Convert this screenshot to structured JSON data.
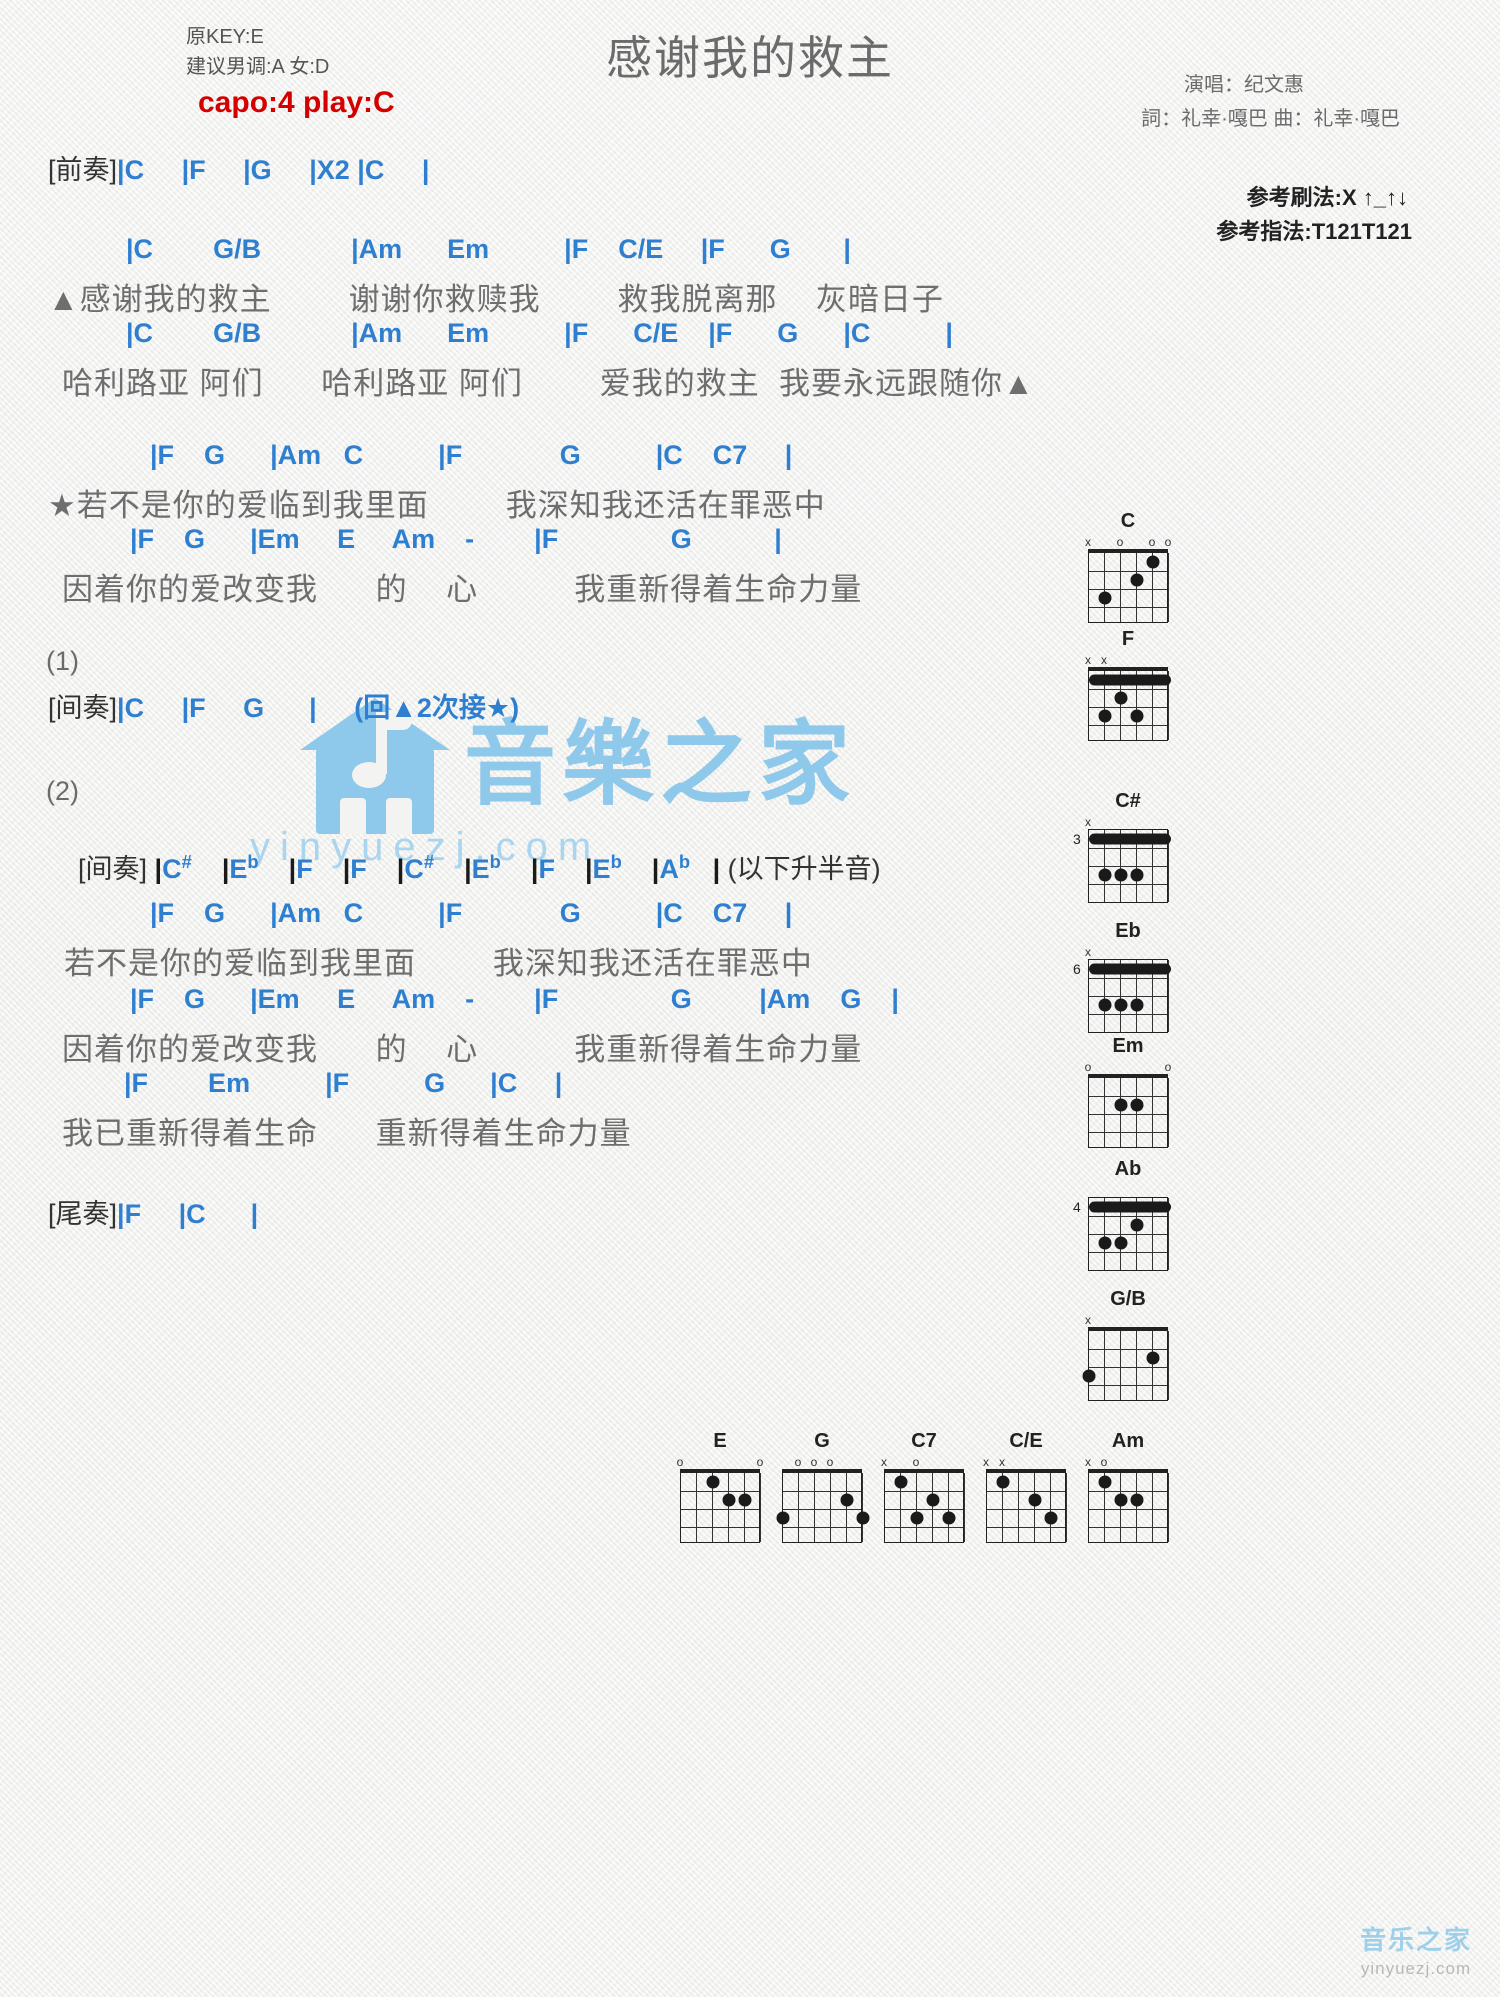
{
  "header": {
    "orig_key": "原KEY:E",
    "suggest_key": "建议男调:A 女:D",
    "capo": "capo:4 play:C",
    "title": "感谢我的救主",
    "singer": "演唱：纪文惠",
    "writers": "詞：礼幸·嘎巴   曲：礼幸·嘎巴",
    "strum_ref": "参考刷法:X ↑_↑↓",
    "finger_ref": "参考指法:T121T121",
    "capo_color": "#d40000",
    "chord_color": "#2f7fd0",
    "lyric_color": "#6e6e6e"
  },
  "body": {
    "intro_tag": "[前奏]",
    "intro_chords": "|C     |F     |G     |X2 |C     |",
    "v1_chords": "|C        G/B            |Am      Em          |F    C/E     |F      G       |",
    "v1_lyrics": "▲感谢我的救主        谢谢你救赎我        救我脱离那    灰暗日子",
    "v2_chords": "|C        G/B            |Am      Em          |F      C/E    |F      G      |C          |",
    "v2_lyrics": "哈利路亚 阿们      哈利路亚 阿们        爱我的救主  我要永远跟随你▲",
    "c1_chords": "|F    G      |Am   C          |F             G          |C    C7     |",
    "c1_lyrics": "★若不是你的爱临到我里面        我深知我还活在罪恶中",
    "c2_chords": "|F    G      |Em     E     Am    -        |F               G           |",
    "c2_lyrics": "因着你的爱改变我      的    心          我重新得着生命力量",
    "num1": "(1)",
    "inter1_tag": "[间奏]",
    "inter1_chords": "|C     |F     G      |     (回▲2次接★)",
    "num2": "(2)",
    "inter2_tag": "[间奏]",
    "inter2_chords_parts": [
      {
        "root": "C",
        "acc": "#"
      },
      {
        "root": "E",
        "acc": "b"
      },
      {
        "root": "F",
        "acc": ""
      },
      {
        "root": "F",
        "acc": ""
      },
      {
        "root": "C",
        "acc": "#"
      },
      {
        "root": "E",
        "acc": "b"
      },
      {
        "root": "F",
        "acc": ""
      },
      {
        "root": "E",
        "acc": "b"
      },
      {
        "root": "A",
        "acc": "b"
      }
    ],
    "inter2_note": "(以下升半音)",
    "c3_chords": "|F    G      |Am   C          |F             G          |C    C7     |",
    "c3_lyrics": "若不是你的爱临到我里面        我深知我还活在罪恶中",
    "c4_chords": "|F    G      |Em     E     Am    -        |F               G         |Am    G    |",
    "c4_lyrics": "因着你的爱改变我      的    心          我重新得着生命力量",
    "c5_chords": "|F        Em          |F          G      |C     |",
    "c5_lyrics": "我已重新得着生命      重新得着生命力量",
    "outro_tag": "[尾奏]",
    "outro_chords": "|F     |C      |"
  },
  "watermark": {
    "brand": "音樂之家",
    "url": "yinyuezj.com",
    "corner_brand": "音乐之家",
    "corner_url": "yinyuezj.com"
  },
  "diagrams_right": [
    {
      "name": "C",
      "base": 0,
      "open": [
        "x",
        "",
        "o",
        "",
        "o",
        "o"
      ],
      "dots": [
        [
          5,
          1
        ],
        [
          4,
          2
        ],
        [
          2,
          3
        ]
      ],
      "barre": null
    },
    {
      "name": "F",
      "base": 0,
      "open": [
        "x",
        "x",
        "",
        "",
        "",
        ""
      ],
      "dots": [
        [
          3,
          2
        ],
        [
          2,
          3
        ],
        [
          4,
          3
        ]
      ],
      "barre": {
        "fret": 1,
        "from": 1,
        "to": 6
      }
    },
    {
      "name": "C#",
      "base": 3,
      "open": [
        "x",
        "",
        "",
        "",
        "",
        ""
      ],
      "dots": [
        [
          3,
          3
        ],
        [
          4,
          3
        ],
        [
          2,
          3
        ]
      ],
      "barre": {
        "fret": 1,
        "from": 1,
        "to": 6
      }
    },
    {
      "name": "Eb",
      "base": 6,
      "open": [
        "x",
        "",
        "",
        "",
        "",
        ""
      ],
      "dots": [
        [
          3,
          3
        ],
        [
          4,
          3
        ],
        [
          2,
          3
        ]
      ],
      "barre": {
        "fret": 1,
        "from": 1,
        "to": 6
      }
    },
    {
      "name": "Em",
      "base": 0,
      "open": [
        "o",
        "",
        "",
        "",
        "",
        "o"
      ],
      "dots": [
        [
          4,
          2
        ],
        [
          3,
          2
        ]
      ],
      "barre": null
    },
    {
      "name": "Ab",
      "base": 4,
      "open": [
        "",
        "",
        "",
        "",
        "",
        ""
      ],
      "dots": [
        [
          4,
          2
        ],
        [
          3,
          3
        ],
        [
          2,
          3
        ]
      ],
      "barre": {
        "fret": 1,
        "from": 1,
        "to": 6
      }
    },
    {
      "name": "G/B",
      "base": 0,
      "open": [
        "x",
        "",
        "",
        "",
        "",
        ""
      ],
      "dots": [
        [
          5,
          2
        ],
        [
          1,
          3
        ]
      ],
      "barre": null
    }
  ],
  "diagrams_bottom": [
    {
      "name": "E",
      "base": 0,
      "open": [
        "o",
        "",
        "",
        "",
        "",
        "o"
      ],
      "dots": [
        [
          5,
          2
        ],
        [
          4,
          2
        ],
        [
          3,
          1
        ]
      ],
      "barre": null
    },
    {
      "name": "G",
      "base": 0,
      "open": [
        "",
        "o",
        "o",
        "o",
        "",
        ""
      ],
      "dots": [
        [
          6,
          3
        ],
        [
          5,
          2
        ],
        [
          1,
          3
        ]
      ],
      "barre": null
    },
    {
      "name": "C7",
      "base": 0,
      "open": [
        "x",
        "",
        "o",
        "",
        "",
        ""
      ],
      "dots": [
        [
          5,
          3
        ],
        [
          4,
          2
        ],
        [
          2,
          1
        ],
        [
          3,
          3
        ]
      ],
      "barre": null
    },
    {
      "name": "C/E",
      "base": 0,
      "open": [
        "x",
        "x",
        "",
        "",
        "",
        ""
      ],
      "dots": [
        [
          5,
          3
        ],
        [
          4,
          2
        ],
        [
          2,
          1
        ]
      ],
      "barre": null
    },
    {
      "name": "Am",
      "base": 0,
      "open": [
        "x",
        "o",
        "",
        "",
        "",
        ""
      ],
      "dots": [
        [
          4,
          2
        ],
        [
          3,
          2
        ],
        [
          2,
          1
        ]
      ],
      "barre": null
    }
  ]
}
